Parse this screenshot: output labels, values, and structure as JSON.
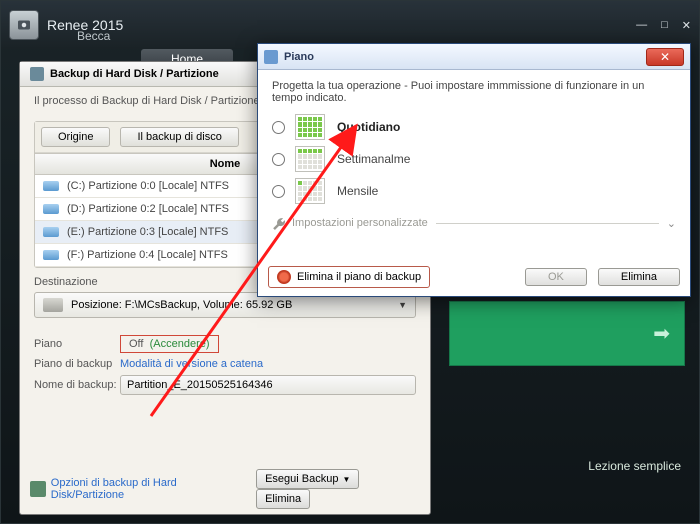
{
  "app": {
    "title": "Renee 2015",
    "subtitle": "Becca"
  },
  "winctrl": {
    "min": "—",
    "max": "□",
    "close": "✕"
  },
  "maintab": "Home",
  "panel": {
    "title": "Backup di Hard Disk / Partizione",
    "process": "Il processo di Backup di Hard Disk / Partizione",
    "tab_origin": "Origine",
    "tab_backup": "Il backup di disco",
    "col_name": "Nome",
    "rows": [
      "(C:) Partizione 0:0 [Locale]  NTFS",
      "(D:) Partizione 0:2 [Locale]  NTFS",
      "(E:) Partizione 0:3 [Locale]  NTFS",
      "(F:) Partizione 0:4 [Locale]  NTFS"
    ],
    "dest_label": "Destinazione",
    "dest_value": "Posizione: F:\\MCsBackup, Volume: 65.92 GB",
    "piano_lbl": "Piano",
    "piano_val_off": "Off",
    "piano_val_on": "(Accendere)",
    "plan_lbl": "Piano di backup",
    "plan_val": "Modalità di versione a catena",
    "name_lbl": "Nome di backup:",
    "name_val": "Partition_E_20150525164346",
    "opt_link": "Opzioni di backup di Hard Disk/Partizione",
    "btn_run": "Esegui Backup",
    "btn_del": "Elimina"
  },
  "lesson": "Lezione semplice",
  "dialog": {
    "title": "Piano",
    "desc": "Progetta la tua operazione - Puoi impostare immmissione di funzionare in un tempo indicato.",
    "opt1": "Quotidiano",
    "opt2": "Settimanalme",
    "opt3": "Mensile",
    "pers": "Impostazioni personalizzate",
    "del": "Elimina il piano di backup",
    "ok": "OK",
    "elim": "Elimina"
  }
}
